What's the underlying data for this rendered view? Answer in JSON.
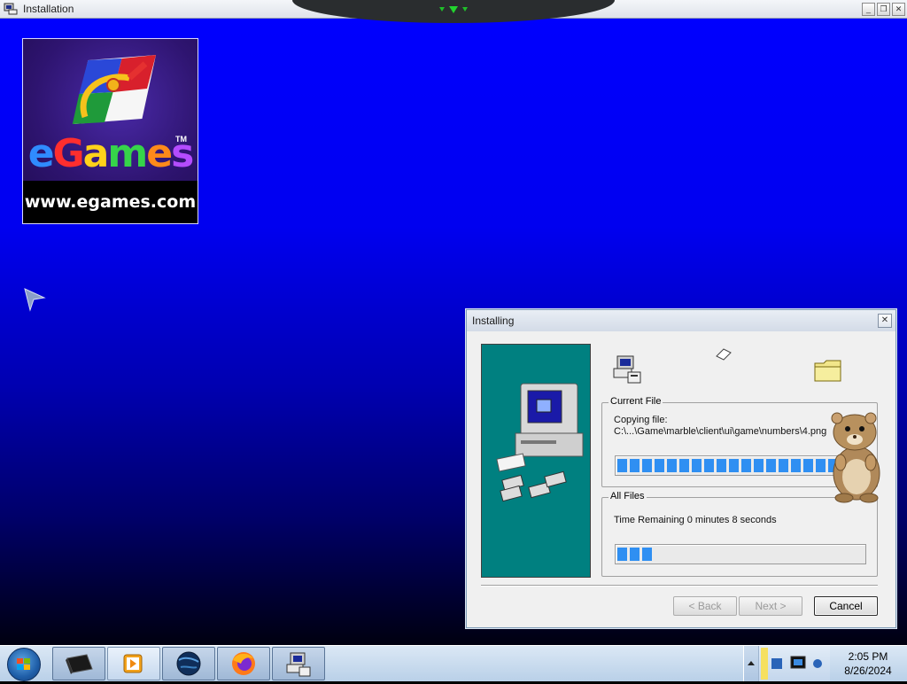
{
  "window": {
    "title": "Installation"
  },
  "logo": {
    "brand": "eGames",
    "tm": "TM",
    "url": "www.egames.com"
  },
  "dialog": {
    "title": "Installing",
    "current_file": {
      "legend": "Current File",
      "label": "Copying file:",
      "path": "C:\\...\\Game\\marble\\client\\ui\\game\\numbers\\4.png",
      "progress": 0.96
    },
    "all_files": {
      "legend": "All Files",
      "time_remaining": "Time Remaining 0 minutes 8 seconds",
      "progress": 0.14
    },
    "buttons": {
      "back": "< Back",
      "next": "Next >",
      "cancel": "Cancel"
    }
  },
  "taskbar": {
    "items": [
      "terminal-icon",
      "media-player-icon",
      "globe-icon",
      "firefox-icon",
      "installer-icon"
    ],
    "clock": {
      "time": "2:05 PM",
      "date": "8/26/2024"
    }
  },
  "colors": {
    "desktop": "#0000ff",
    "dialog_panel": "#008080",
    "progress": "#2f8ff2"
  }
}
